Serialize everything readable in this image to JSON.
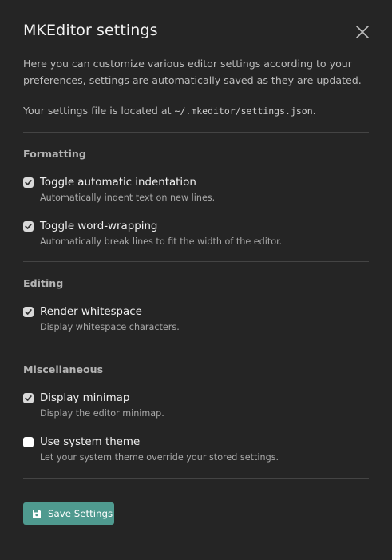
{
  "dialog": {
    "title": "MKEditor settings",
    "intro": "Here you can customize various editor settings according to your preferences, settings are automatically saved as they are updated.",
    "path_prefix": "Your settings file is located at ",
    "path": "~/.mkeditor/settings.json",
    "path_suffix": "."
  },
  "sections": [
    {
      "title": "Formatting",
      "options": [
        {
          "label": "Toggle automatic indentation",
          "desc": "Automatically indent text on new lines.",
          "checked": true
        },
        {
          "label": "Toggle word-wrapping",
          "desc": "Automatically break lines to fit the width of the editor.",
          "checked": true
        }
      ]
    },
    {
      "title": "Editing",
      "options": [
        {
          "label": "Render whitespace",
          "desc": "Display whitespace characters.",
          "checked": true
        }
      ]
    },
    {
      "title": "Miscellaneous",
      "options": [
        {
          "label": "Display minimap",
          "desc": "Display the editor minimap.",
          "checked": true
        },
        {
          "label": "Use system theme",
          "desc": "Let your system theme override your stored settings.",
          "checked": false
        }
      ]
    }
  ],
  "actions": {
    "save_label": "Save Settings",
    "save_icon": "floppy-disk-icon",
    "accent_color": "#4f9a8f"
  }
}
